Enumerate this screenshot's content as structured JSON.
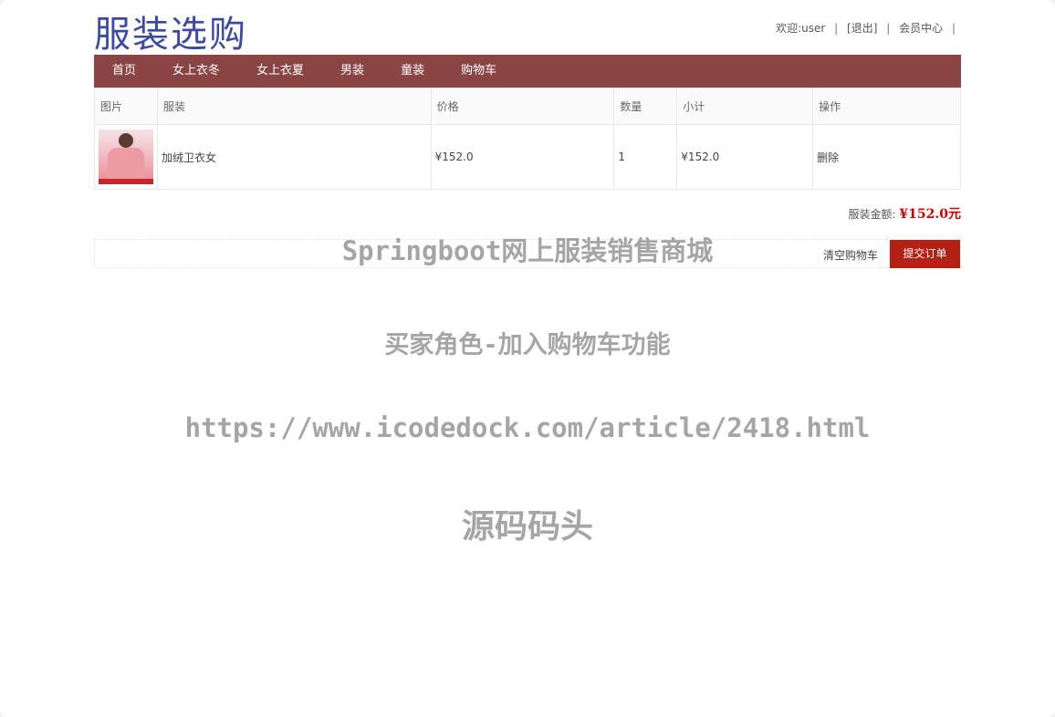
{
  "header": {
    "logo_text": "服装选购",
    "welcome": "欢迎:user",
    "logout": "[退出]",
    "member_center": "会员中心",
    "separator": "|"
  },
  "nav": {
    "items": [
      "首页",
      "女上衣冬",
      "女上衣夏",
      "男装",
      "童装",
      "购物车"
    ]
  },
  "cart": {
    "columns": {
      "image": "图片",
      "product": "服装",
      "price": "价格",
      "quantity": "数量",
      "subtotal": "小计",
      "action": "操作"
    },
    "rows": [
      {
        "name": "加绒卫衣女",
        "price": "¥152.0",
        "quantity": "1",
        "subtotal": "¥152.0",
        "action": "删除"
      }
    ],
    "total_label": "服装金额:",
    "total_value": "¥152.0元",
    "clear_label": "清空购物车",
    "submit_label": "提交订单"
  },
  "watermark": {
    "line1": "Springboot网上服装销售商城",
    "line2": "买家角色-加入购物车功能",
    "line3": "https://www.icodedock.com/article/2418.html",
    "line4": "源码码头"
  },
  "colors": {
    "nav_bg": "#8a4444",
    "submit_bg": "#b52015",
    "price_red": "#d00000",
    "logo_blue": "#3b4aa6"
  }
}
